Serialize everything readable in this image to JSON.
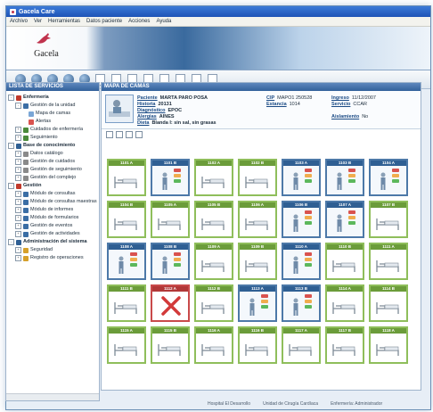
{
  "app": {
    "title": "Gacela Care"
  },
  "menu": [
    "Archivo",
    "Ver",
    "Herramientas",
    "Datos paciente",
    "Acciones",
    "Ayuda"
  ],
  "brand": {
    "name": "Gacela",
    "sub": "care"
  },
  "toolbar": {
    "buttons": [
      {
        "icon": "back-icon",
        "type": "circle"
      },
      {
        "icon": "forward-icon",
        "type": "circle"
      },
      {
        "icon": "home-icon",
        "type": "circle"
      },
      {
        "icon": "refresh-icon",
        "type": "circle"
      },
      {
        "icon": "print-icon",
        "type": "circle"
      },
      {
        "icon": "search-doc-icon",
        "type": "doc",
        "color": "#c33"
      },
      {
        "icon": "patient-doc-icon",
        "type": "doc",
        "color": "#c33"
      },
      {
        "icon": "care-doc-icon",
        "type": "doc",
        "color": "#e07a22"
      },
      {
        "icon": "assessment-doc-icon",
        "type": "doc",
        "color": "#3a8a3a"
      },
      {
        "icon": "plan-doc-icon",
        "type": "doc",
        "color": "#3a8a3a"
      },
      {
        "icon": "report-doc-icon",
        "type": "doc",
        "color": "#3a8a3a"
      },
      {
        "icon": "discharge-doc-icon",
        "type": "doc",
        "color": "#3a8a3a"
      },
      {
        "icon": "exit-doc-icon",
        "type": "doc",
        "color": "#3a8a3a"
      }
    ]
  },
  "left_panel": {
    "header": "LISTA DE SERVICIOS",
    "tree": [
      {
        "level": 0,
        "label": "Enfermería",
        "exp": "-",
        "icon": "#c0392b"
      },
      {
        "level": 1,
        "label": "Gestión de la unidad",
        "exp": "-",
        "icon": "#3b6ea5"
      },
      {
        "level": 2,
        "label": "Mapa de camas",
        "exp": "",
        "icon": "#7aa6d6"
      },
      {
        "level": 2,
        "label": "Alertas",
        "exp": "",
        "icon": "#d9534f"
      },
      {
        "level": 1,
        "label": "Cuidados de enfermería",
        "exp": "+",
        "icon": "#4a8a3a"
      },
      {
        "level": 1,
        "label": "Seguimiento",
        "exp": "+",
        "icon": "#4a8a3a"
      },
      {
        "level": 0,
        "label": "Base de conocimiento",
        "exp": "-",
        "icon": "#2f5f93"
      },
      {
        "level": 1,
        "label": "Datos catálogo",
        "exp": "+",
        "icon": "#8a8a8a"
      },
      {
        "level": 1,
        "label": "Gestión de cuidados",
        "exp": "+",
        "icon": "#8a8a8a"
      },
      {
        "level": 1,
        "label": "Gestión de seguimiento",
        "exp": "+",
        "icon": "#8a8a8a"
      },
      {
        "level": 1,
        "label": "Gestión del complejo",
        "exp": "+",
        "icon": "#8a8a8a"
      },
      {
        "level": 0,
        "label": "Gestión",
        "exp": "-",
        "icon": "#c0392b"
      },
      {
        "level": 1,
        "label": "Módulo de consultas",
        "exp": "+",
        "icon": "#3b6ea5"
      },
      {
        "level": 1,
        "label": "Módulo de consultas maestras",
        "exp": "+",
        "icon": "#3b6ea5"
      },
      {
        "level": 1,
        "label": "Módulo de informes",
        "exp": "+",
        "icon": "#3b6ea5"
      },
      {
        "level": 1,
        "label": "Módulo de formularios",
        "exp": "+",
        "icon": "#3b6ea5"
      },
      {
        "level": 1,
        "label": "Gestión de eventos",
        "exp": "+",
        "icon": "#3b6ea5"
      },
      {
        "level": 1,
        "label": "Gestión de actividades",
        "exp": "+",
        "icon": "#3b6ea5"
      },
      {
        "level": 0,
        "label": "Administración del sistema",
        "exp": "-",
        "icon": "#2f5f93"
      },
      {
        "level": 1,
        "label": "Seguridad",
        "exp": "+",
        "icon": "#d6a02a"
      },
      {
        "level": 1,
        "label": "Registro de operaciones",
        "exp": "+",
        "icon": "#d6a02a"
      }
    ]
  },
  "right_panel": {
    "header": "MAPA DE CAMAS",
    "patient": {
      "fields": [
        {
          "label": "Paciente",
          "value": "MARTA PARO POSA"
        },
        {
          "label": "Historia",
          "value": "20131"
        },
        {
          "label": "Diagnóstico",
          "value": "EPOC"
        },
        {
          "label": "Alergias",
          "value": "AINES"
        },
        {
          "label": "Dieta",
          "value": "Blanda I: sin sal, sin grasas"
        }
      ],
      "right_fields": [
        {
          "label": "CIP",
          "value": "MAPO1 250528"
        },
        {
          "label": "Estancia",
          "value": "1014"
        },
        {
          "label": "Ingreso",
          "value": "11/12/2007"
        },
        {
          "label": "Servicio",
          "value": "CCAR"
        },
        {
          "label": "Aislamiento",
          "value": "No"
        }
      ]
    },
    "beds": [
      {
        "label": "1101 A",
        "state": "empty"
      },
      {
        "label": "1101 B",
        "state": "occ"
      },
      {
        "label": "1102 A",
        "state": "empty"
      },
      {
        "label": "1102 B",
        "state": "empty"
      },
      {
        "label": "1103 A",
        "state": "occ"
      },
      {
        "label": "1103 B",
        "state": "occ"
      },
      {
        "label": "1104 A",
        "state": "occ"
      },
      {
        "label": "1104 B",
        "state": "empty"
      },
      {
        "label": "1105 A",
        "state": "empty"
      },
      {
        "label": "1105 B",
        "state": "empty"
      },
      {
        "label": "1106 A",
        "state": "empty"
      },
      {
        "label": "1106 B",
        "state": "occ"
      },
      {
        "label": "1107 A",
        "state": "occ"
      },
      {
        "label": "1107 B",
        "state": "empty"
      },
      {
        "label": "1108 A",
        "state": "occ"
      },
      {
        "label": "1108 B",
        "state": "occ"
      },
      {
        "label": "1109 A",
        "state": "empty"
      },
      {
        "label": "1109 B",
        "state": "empty"
      },
      {
        "label": "1110 A",
        "state": "occ"
      },
      {
        "label": "1110 B",
        "state": "empty"
      },
      {
        "label": "1111 A",
        "state": "empty"
      },
      {
        "label": "1111 B",
        "state": "empty"
      },
      {
        "label": "1112 A",
        "state": "red"
      },
      {
        "label": "1112 B",
        "state": "empty"
      },
      {
        "label": "1113 A",
        "state": "occ"
      },
      {
        "label": "1113 B",
        "state": "occ"
      },
      {
        "label": "1114 A",
        "state": "empty"
      },
      {
        "label": "1114 B",
        "state": "empty"
      },
      {
        "label": "1115 A",
        "state": "empty"
      },
      {
        "label": "1115 B",
        "state": "empty"
      },
      {
        "label": "1116 A",
        "state": "empty"
      },
      {
        "label": "1116 B",
        "state": "empty"
      },
      {
        "label": "1117 A",
        "state": "empty"
      },
      {
        "label": "1117 B",
        "state": "empty"
      },
      {
        "label": "1118 A",
        "state": "empty"
      }
    ]
  },
  "statusbar": [
    "Hospital El Desarrollo",
    "Unidad de Cirugía Cardíaca",
    "Enfermería: Administrador"
  ]
}
